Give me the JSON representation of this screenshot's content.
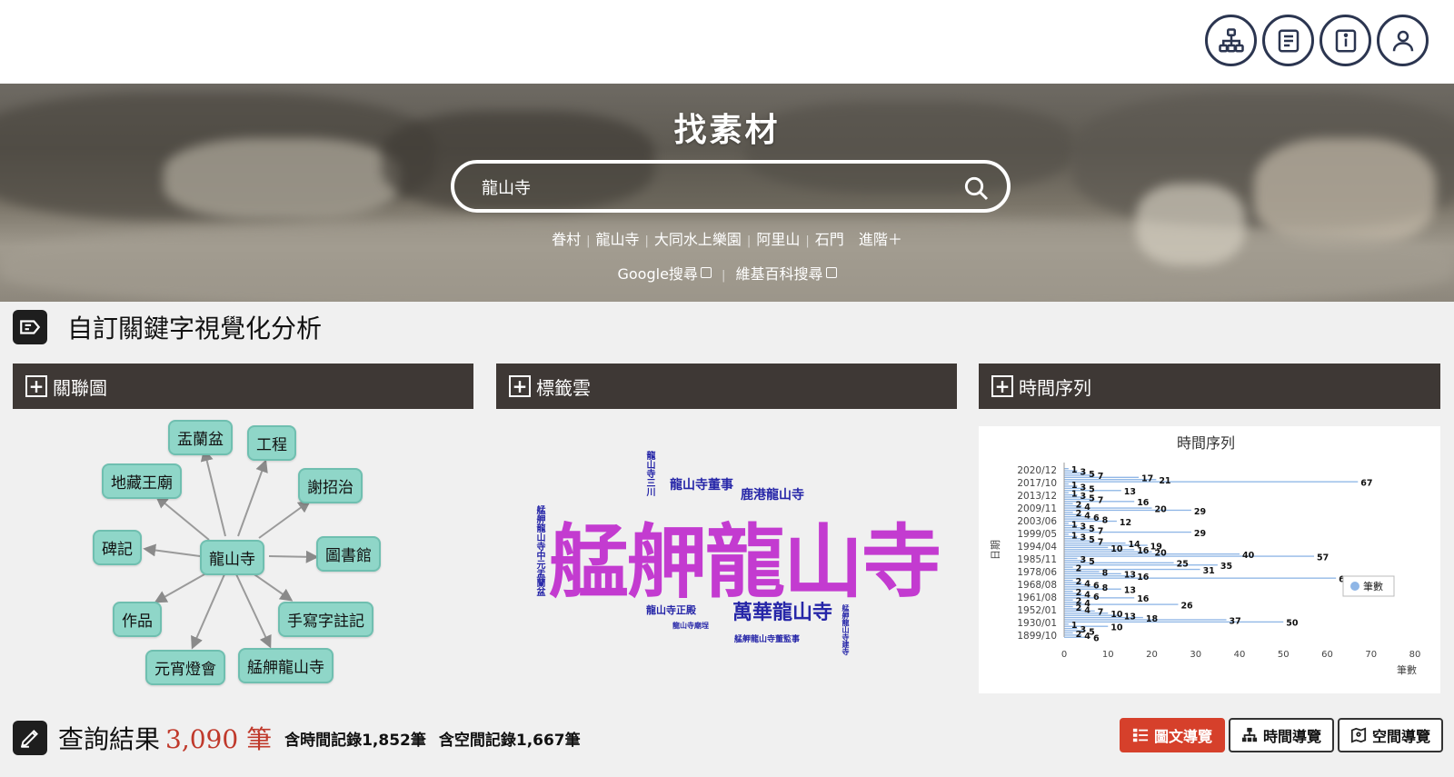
{
  "header": {
    "icons": [
      "sitemap-icon",
      "document-icon",
      "info-icon",
      "user-icon"
    ]
  },
  "hero": {
    "title": "找素材",
    "search_value": "龍山寺",
    "quick_links": [
      "眷村",
      "龍山寺",
      "大同水上樂園",
      "阿里山",
      "石門"
    ],
    "advanced": "進階＋",
    "external": [
      "Google搜尋",
      "維基百科搜尋"
    ]
  },
  "section": {
    "title": "自訂關鍵字視覺化分析"
  },
  "panels": {
    "graph": "關聯圖",
    "cloud": "標籤雲",
    "timeline": "時間序列"
  },
  "graph": {
    "center": "龍山寺",
    "nodes": [
      "盂蘭盆",
      "工程",
      "地藏王廟",
      "謝招治",
      "碑記",
      "圖書館",
      "作品",
      "手寫字註記",
      "元宵燈會",
      "艋舺龍山寺"
    ]
  },
  "cloud": {
    "words": [
      "艋舺龍山寺",
      "萬華龍山寺",
      "龍山寺董事",
      "鹿港龍山寺",
      "龍山寺三川",
      "艋舺龍山寺中元盂蘭盆",
      "龍山寺正殿",
      "龍山寺廟埕",
      "艋舺龍山寺董監事",
      "艋舺龍山寺建寺"
    ]
  },
  "chart_data": {
    "type": "bar",
    "orientation": "horizontal",
    "title": "時間序列",
    "xlabel": "筆數",
    "ylabel": "日期",
    "xlim": [
      0,
      80
    ],
    "xticks": [
      0,
      10,
      20,
      30,
      40,
      50,
      60,
      70,
      80
    ],
    "yticks": [
      "2020/12",
      "2017/10",
      "2013/12",
      "2009/11",
      "2003/06",
      "1999/05",
      "1994/04",
      "1985/11",
      "1978/06",
      "1968/08",
      "1961/08",
      "1952/01",
      "1930/01",
      "1899/10"
    ],
    "legend": "筆數",
    "legend_position": "right",
    "series": [
      {
        "name": "筆數",
        "values": [
          1,
          3,
          5,
          7,
          17,
          21,
          67,
          1,
          3,
          5,
          13,
          1,
          3,
          5,
          7,
          16,
          2,
          4,
          20,
          29,
          2,
          4,
          6,
          8,
          12,
          1,
          3,
          5,
          7,
          29,
          1,
          3,
          5,
          7,
          14,
          19,
          10,
          16,
          20,
          40,
          57,
          3,
          5,
          25,
          35,
          2,
          31,
          8,
          13,
          16,
          62,
          2,
          4,
          6,
          8,
          13,
          2,
          4,
          6,
          16,
          2,
          4,
          26,
          2,
          4,
          7,
          10,
          13,
          18,
          37,
          50,
          1,
          10,
          3,
          5,
          2,
          4,
          6
        ]
      }
    ]
  },
  "results": {
    "label": "查詢結果",
    "count": "3,090 筆",
    "time_records": "含時間記錄1,852筆",
    "space_records": "含空間記錄1,667筆",
    "buttons": [
      "圖文導覽",
      "時間導覽",
      "空間導覽"
    ]
  }
}
